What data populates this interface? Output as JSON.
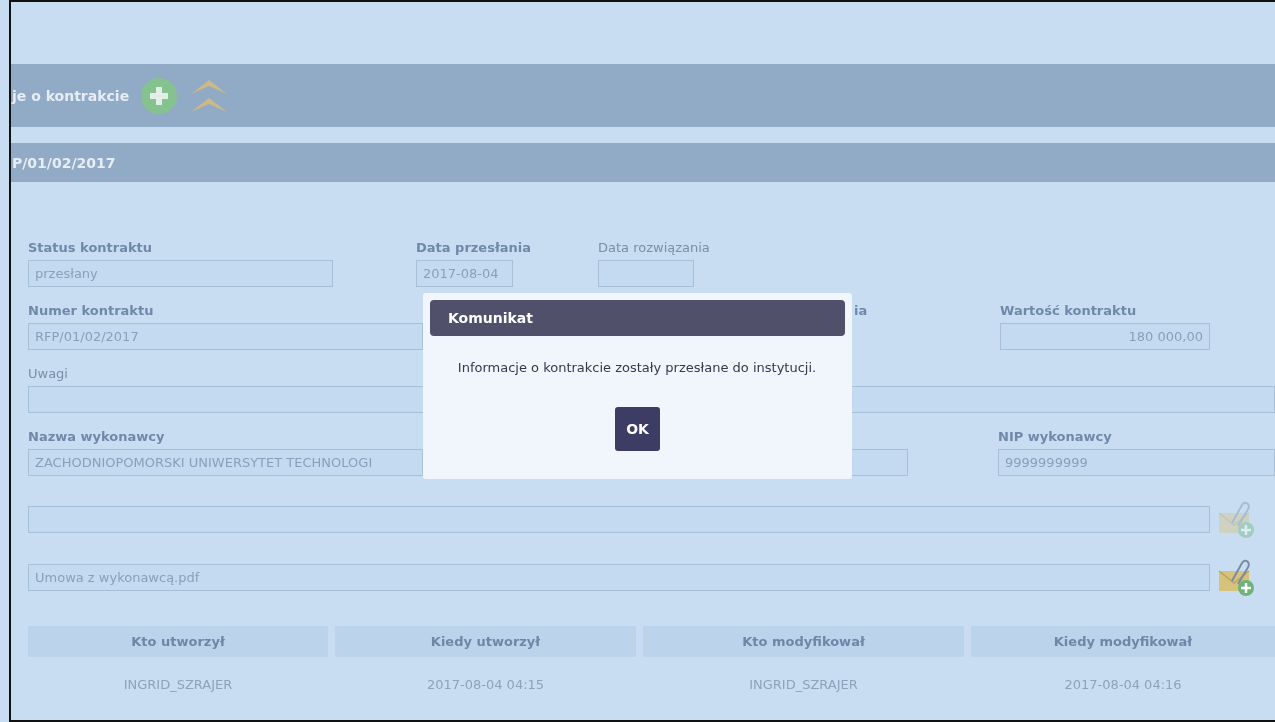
{
  "header": {
    "title": "je o kontrakcie"
  },
  "subheader": {
    "title": "P/01/02/2017"
  },
  "form": {
    "rows": [
      [
        {
          "label": "Status kontraktu",
          "required": true,
          "value": "przesłany"
        },
        {
          "label": "Data przesłania",
          "required": true,
          "value": "2017-08-04"
        },
        {
          "label": "Data rozwiązania",
          "required": false
        }
      ],
      [
        {
          "label": "Numer kontraktu",
          "required": true,
          "value": "RFP/01/02/2017"
        },
        {
          "label": "ia",
          "required": true,
          "kind": "label"
        },
        {
          "label": "Wartość kontraktu",
          "required": true,
          "value": "180 000,00",
          "kind": "amount"
        }
      ],
      [
        {
          "label": "Uwagi",
          "required": false
        }
      ],
      [
        {
          "label": "Nazwa wykonawcy",
          "required": true,
          "value": "ZACHODNIOPOMORSKI UNIWERSYTET TECHNOLOGI"
        },
        {},
        {
          "label": "NIP wykonawcy",
          "required": true,
          "value": "9999999999"
        }
      ]
    ],
    "attachments": [
      {
        "disabled": true
      },
      {
        "value": "Umowa z wykonawcą.pdf",
        "disabled": false
      }
    ]
  },
  "table": {
    "columns": [
      "Kto utworzył",
      "Kiedy utworzył",
      "Kto modyfikował",
      "Kiedy modyfikował"
    ],
    "rows": [
      [
        "INGRID_SZRAJER",
        "2017-08-04 04:15",
        "INGRID_SZRAJER",
        "2017-08-04 04:16"
      ]
    ]
  },
  "dialog": {
    "title": "Komunikat",
    "message": "Informacje o kontrakcie zostały przesłane do instytucji.",
    "buttons": [
      "OK"
    ]
  }
}
